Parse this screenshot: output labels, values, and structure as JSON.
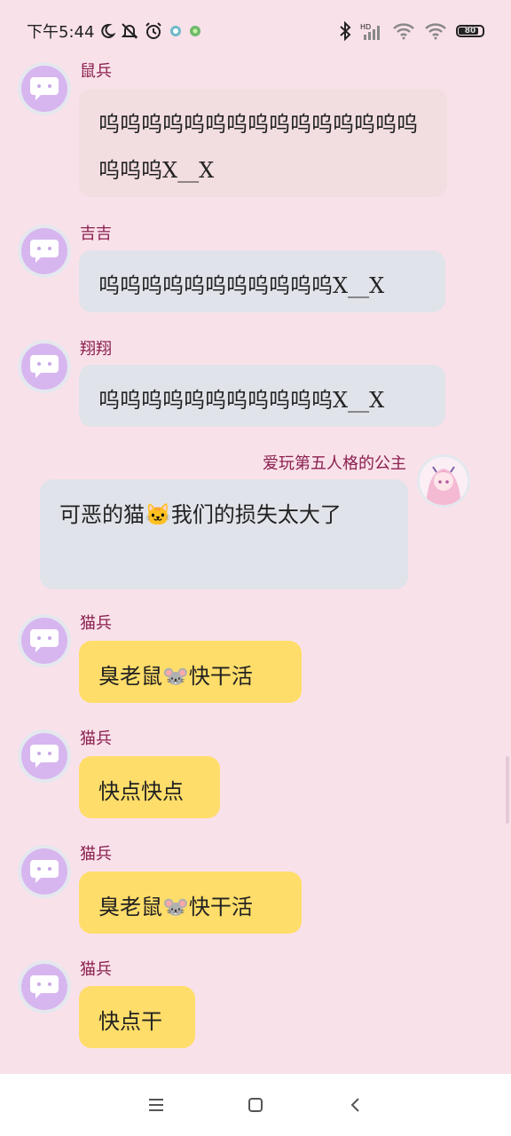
{
  "status_bar": {
    "time": "下午5:44",
    "battery": "80",
    "battery_level": 0.8
  },
  "messages": [
    {
      "sender": "鼠兵",
      "text": "呜呜呜呜呜呜呜呜呜呜呜呜呜呜呜呜呜呜X__X",
      "side": "left",
      "color": "pink"
    },
    {
      "sender": "吉吉",
      "text": "呜呜呜呜呜呜呜呜呜呜呜X__X",
      "side": "left",
      "color": "grey"
    },
    {
      "sender": "翔翔",
      "text": "呜呜呜呜呜呜呜呜呜呜呜X__X",
      "side": "left",
      "color": "grey"
    },
    {
      "sender": "爱玩第五人格的公主",
      "text": "可恶的猫🐱我们的损失太大了",
      "side": "right",
      "color": "grey"
    },
    {
      "sender": "猫兵",
      "text": "臭老鼠🐭快干活",
      "side": "left",
      "color": "yellow"
    },
    {
      "sender": "猫兵",
      "text": "快点快点",
      "side": "left",
      "color": "yellow"
    },
    {
      "sender": "猫兵",
      "text": "臭老鼠🐭快干活",
      "side": "left",
      "color": "yellow"
    },
    {
      "sender": "猫兵",
      "text": "快点干",
      "side": "left",
      "color": "yellow"
    }
  ],
  "colors": {
    "background": "#f9e1ea",
    "sender_name": "#8a1f4e",
    "bubble_grey": "#e1e3ea",
    "bubble_pink": "#f2dde0",
    "bubble_yellow": "#ffdd6a",
    "avatar": "#d7b6f0"
  },
  "icons": {
    "status_left": [
      "moon-icon",
      "bell-off-icon",
      "alarm-icon",
      "app-icon",
      "app-icon"
    ],
    "status_right": [
      "bluetooth-icon",
      "signal-icon",
      "wifi-icon",
      "wifi-icon",
      "battery-icon"
    ],
    "nav": [
      "menu-icon",
      "home-icon",
      "back-icon"
    ]
  }
}
